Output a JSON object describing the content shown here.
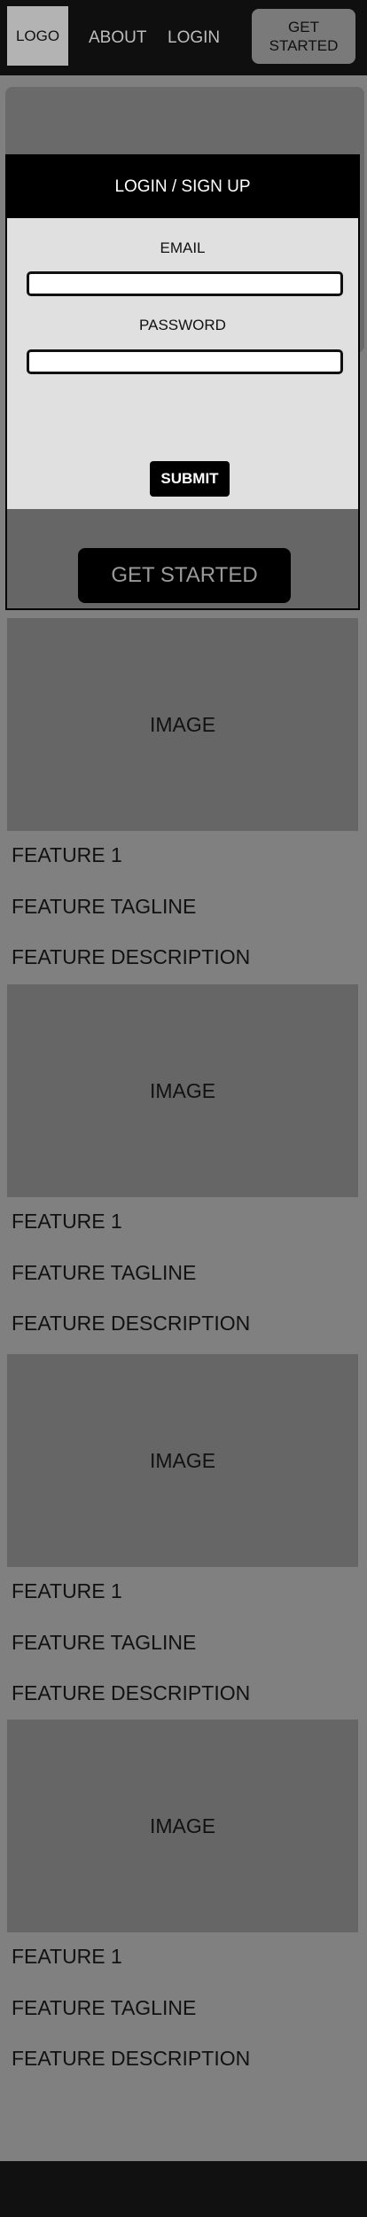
{
  "nav": {
    "logo": "LOGO",
    "about": "ABOUT",
    "login": "LOGIN",
    "cta": "GET STARTED"
  },
  "modal": {
    "title": "LOGIN / SIGN UP",
    "email_label": "EMAIL",
    "password_label": "PASSWORD",
    "email_value": "",
    "password_value": "",
    "submit": "SUBMIT"
  },
  "hero": {
    "cta": "GET STARTED"
  },
  "features": [
    {
      "image": "IMAGE",
      "title": "FEATURE 1",
      "tagline": "FEATURE TAGLINE",
      "description": "FEATURE DESCRIPTION"
    },
    {
      "image": "IMAGE",
      "title": "FEATURE 1",
      "tagline": "FEATURE TAGLINE",
      "description": "FEATURE DESCRIPTION"
    },
    {
      "image": "IMAGE",
      "title": "FEATURE 1",
      "tagline": "FEATURE TAGLINE",
      "description": "FEATURE DESCRIPTION"
    },
    {
      "image": "IMAGE",
      "title": "FEATURE 1",
      "tagline": "FEATURE TAGLINE",
      "description": "FEATURE DESCRIPTION"
    }
  ],
  "colors": {
    "page_background": "#808080",
    "nav_background": "#0f0f0f",
    "modal_background": "#e0e0e0",
    "placeholder_gray": "#666666",
    "button_black": "#000000"
  }
}
